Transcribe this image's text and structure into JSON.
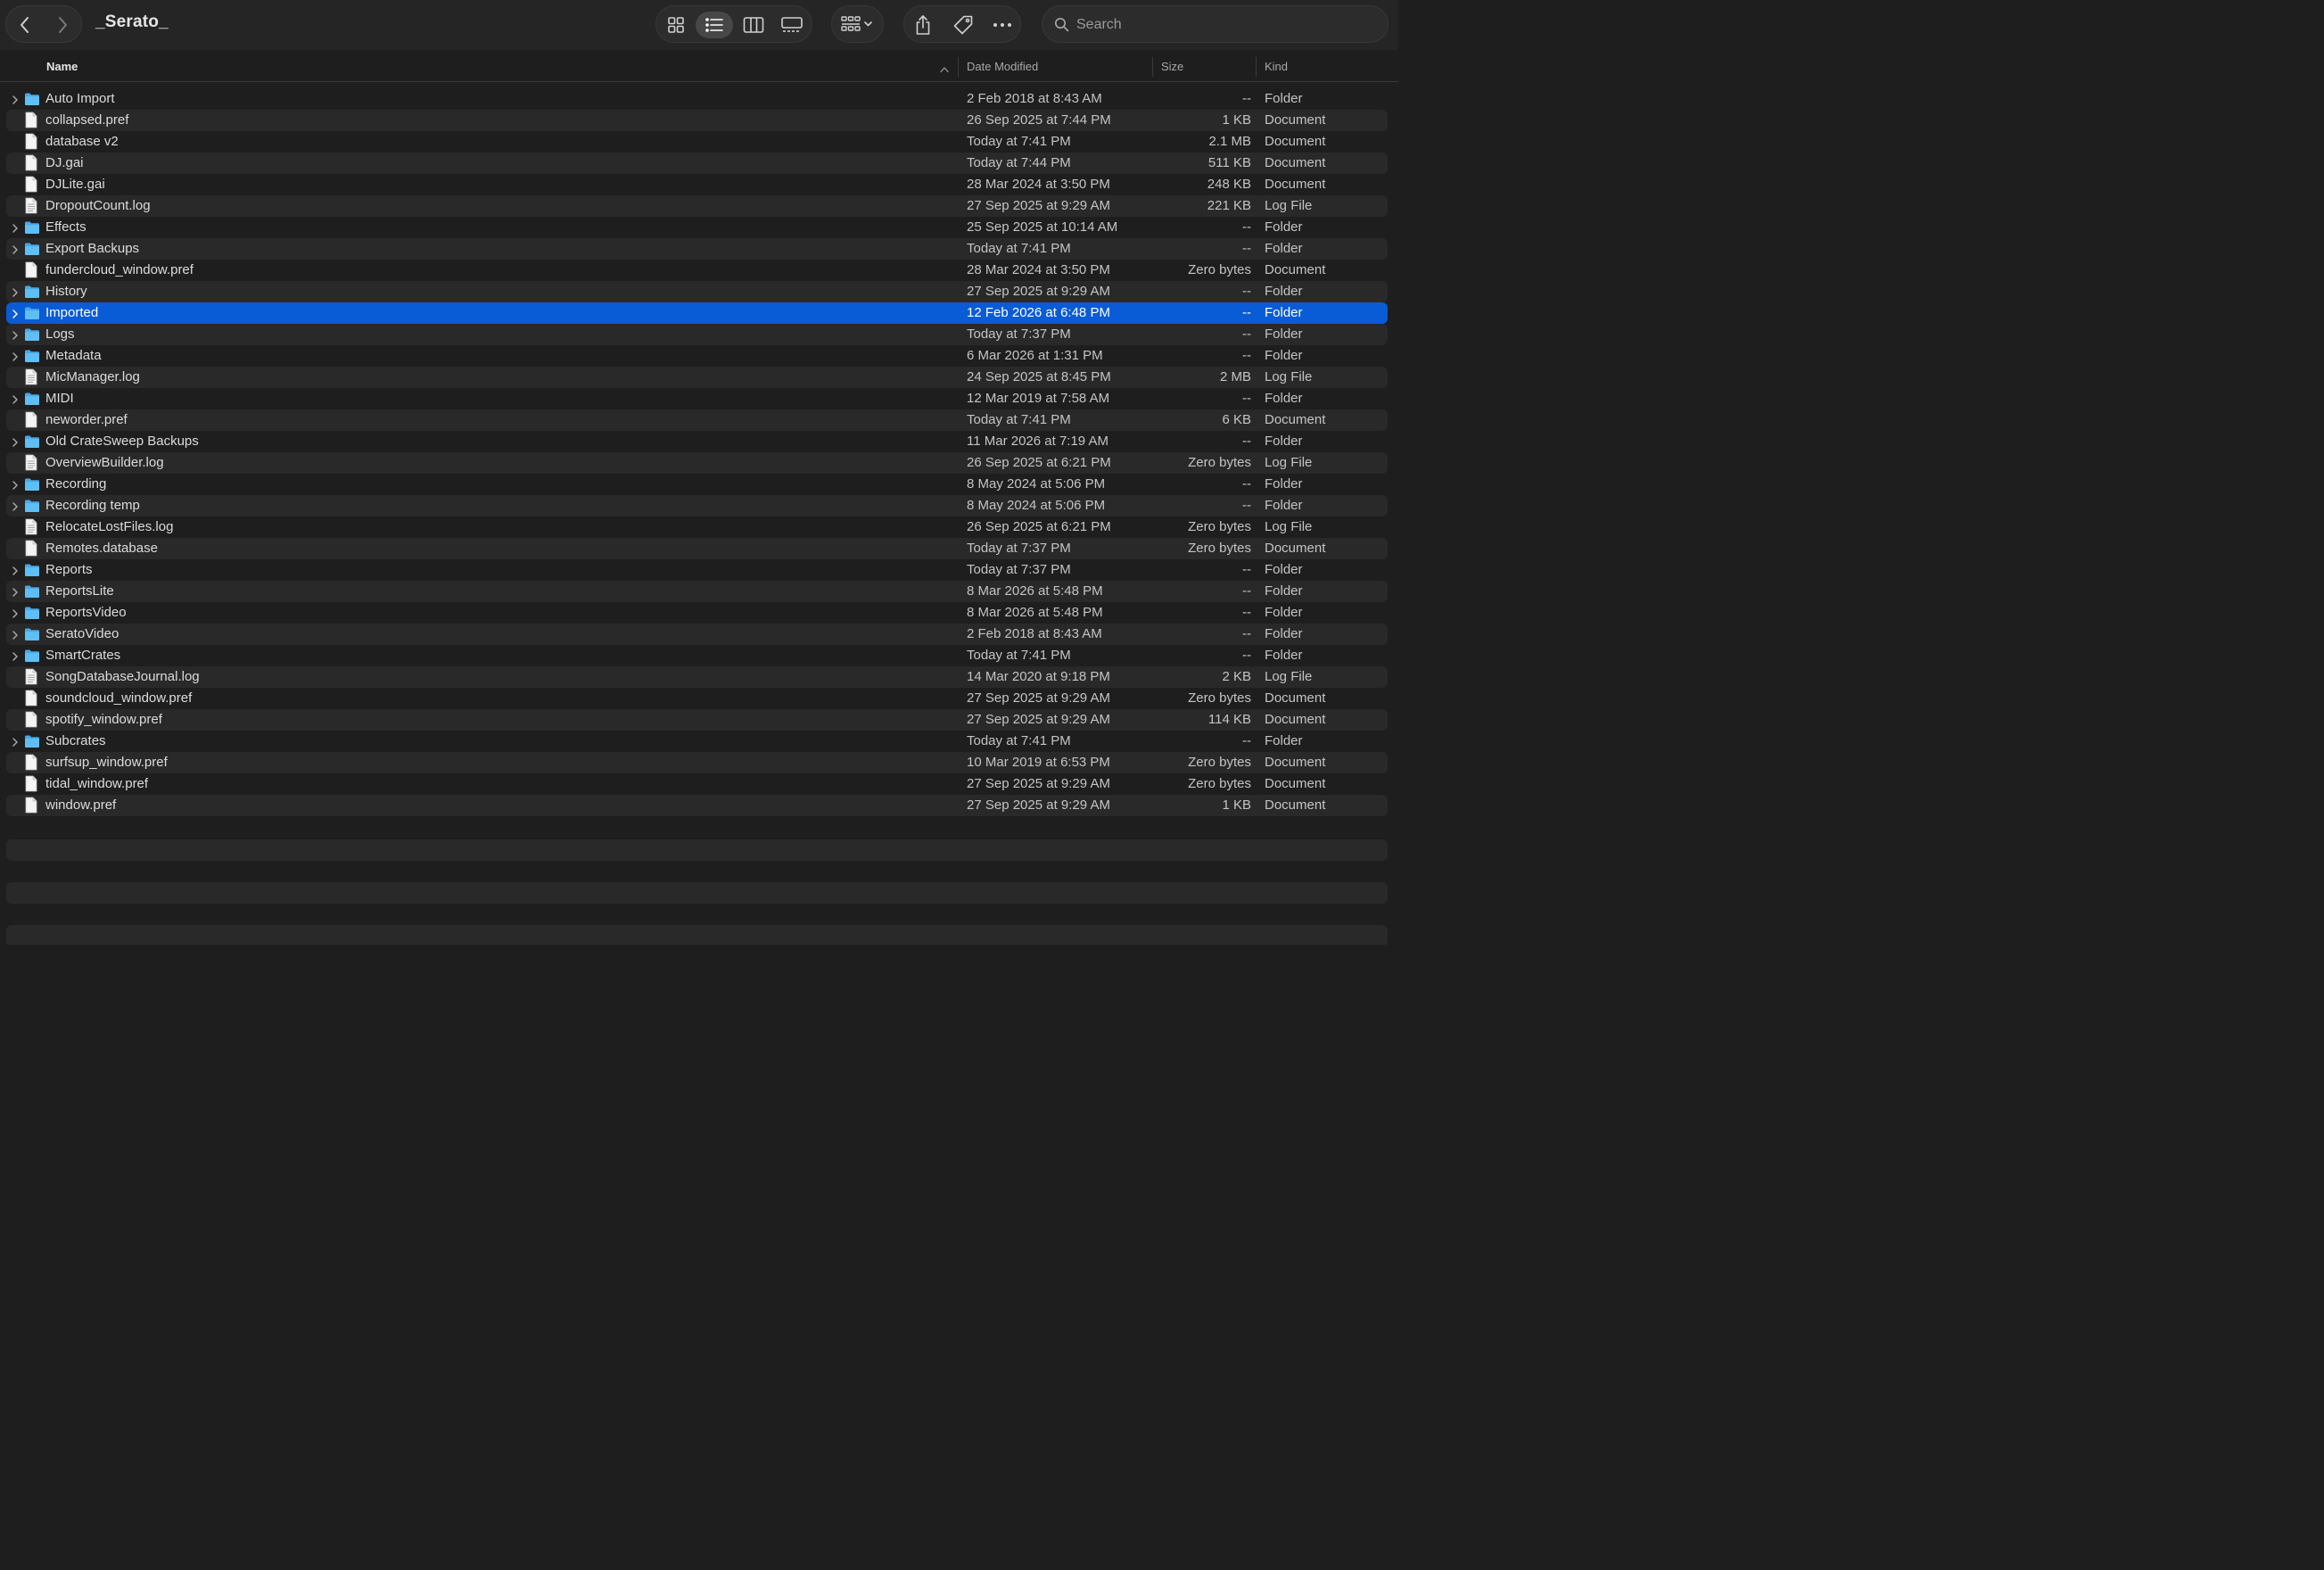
{
  "window": {
    "title": "_Serato_"
  },
  "toolbar": {
    "back_icon": "chevron-left-icon",
    "forward_icon": "chevron-right-icon",
    "view_modes": [
      "icon-view",
      "list-view",
      "column-view",
      "gallery-view"
    ],
    "active_view": "list-view",
    "group_icon": "group-by-icon",
    "share_icon": "share-icon",
    "tag_icon": "tag-icon",
    "more_icon": "ellipsis-icon"
  },
  "search": {
    "placeholder": "Search",
    "value": ""
  },
  "columns": {
    "name": "Name",
    "date": "Date Modified",
    "size": "Size",
    "kind": "Kind"
  },
  "colors": {
    "selection": "#0a5bd6",
    "folder": "#4fb4f0",
    "background": "#1e1e1e"
  },
  "files": [
    {
      "name": "Auto Import",
      "date": "2 Feb 2018 at 8:43 AM",
      "size": "--",
      "kind": "Folder",
      "folder": true
    },
    {
      "name": "collapsed.pref",
      "date": "26 Sep 2025 at 7:44 PM",
      "size": "1 KB",
      "kind": "Document",
      "folder": false
    },
    {
      "name": "database v2",
      "date": "Today at 7:41 PM",
      "size": "2.1 MB",
      "kind": "Document",
      "folder": false
    },
    {
      "name": "DJ.gai",
      "date": "Today at 7:44 PM",
      "size": "511 KB",
      "kind": "Document",
      "folder": false
    },
    {
      "name": "DJLite.gai",
      "date": "28 Mar 2024 at 3:50 PM",
      "size": "248 KB",
      "kind": "Document",
      "folder": false
    },
    {
      "name": "DropoutCount.log",
      "date": "27 Sep 2025 at 9:29 AM",
      "size": "221 KB",
      "kind": "Log File",
      "folder": false
    },
    {
      "name": "Effects",
      "date": "25 Sep 2025 at 10:14 AM",
      "size": "--",
      "kind": "Folder",
      "folder": true
    },
    {
      "name": "Export Backups",
      "date": "Today at 7:41 PM",
      "size": "--",
      "kind": "Folder",
      "folder": true
    },
    {
      "name": "fundercloud_window.pref",
      "date": "28 Mar 2024 at 3:50 PM",
      "size": "Zero bytes",
      "kind": "Document",
      "folder": false
    },
    {
      "name": "History",
      "date": "27 Sep 2025 at 9:29 AM",
      "size": "--",
      "kind": "Folder",
      "folder": true
    },
    {
      "name": "Imported",
      "date": "12 Feb 2026 at 6:48 PM",
      "size": "--",
      "kind": "Folder",
      "folder": true,
      "selected": true
    },
    {
      "name": "Logs",
      "date": "Today at 7:37 PM",
      "size": "--",
      "kind": "Folder",
      "folder": true
    },
    {
      "name": "Metadata",
      "date": "6 Mar 2026 at 1:31 PM",
      "size": "--",
      "kind": "Folder",
      "folder": true
    },
    {
      "name": "MicManager.log",
      "date": "24 Sep 2025 at 8:45 PM",
      "size": "2 MB",
      "kind": "Log File",
      "folder": false
    },
    {
      "name": "MIDI",
      "date": "12 Mar 2019 at 7:58 AM",
      "size": "--",
      "kind": "Folder",
      "folder": true
    },
    {
      "name": "neworder.pref",
      "date": "Today at 7:41 PM",
      "size": "6 KB",
      "kind": "Document",
      "folder": false
    },
    {
      "name": "Old CrateSweep Backups",
      "date": "11 Mar 2026 at 7:19 AM",
      "size": "--",
      "kind": "Folder",
      "folder": true
    },
    {
      "name": "OverviewBuilder.log",
      "date": "26 Sep 2025 at 6:21 PM",
      "size": "Zero bytes",
      "kind": "Log File",
      "folder": false
    },
    {
      "name": "Recording",
      "date": "8 May 2024 at 5:06 PM",
      "size": "--",
      "kind": "Folder",
      "folder": true
    },
    {
      "name": "Recording temp",
      "date": "8 May 2024 at 5:06 PM",
      "size": "--",
      "kind": "Folder",
      "folder": true
    },
    {
      "name": "RelocateLostFiles.log",
      "date": "26 Sep 2025 at 6:21 PM",
      "size": "Zero bytes",
      "kind": "Log File",
      "folder": false
    },
    {
      "name": "Remotes.database",
      "date": "Today at 7:37 PM",
      "size": "Zero bytes",
      "kind": "Document",
      "folder": false
    },
    {
      "name": "Reports",
      "date": "Today at 7:37 PM",
      "size": "--",
      "kind": "Folder",
      "folder": true
    },
    {
      "name": "ReportsLite",
      "date": "8 Mar 2026 at 5:48 PM",
      "size": "--",
      "kind": "Folder",
      "folder": true
    },
    {
      "name": "ReportsVideo",
      "date": "8 Mar 2026 at 5:48 PM",
      "size": "--",
      "kind": "Folder",
      "folder": true
    },
    {
      "name": "SeratoVideo",
      "date": "2 Feb 2018 at 8:43 AM",
      "size": "--",
      "kind": "Folder",
      "folder": true
    },
    {
      "name": "SmartCrates",
      "date": "Today at 7:41 PM",
      "size": "--",
      "kind": "Folder",
      "folder": true
    },
    {
      "name": "SongDatabaseJournal.log",
      "date": "14 Mar 2020 at 9:18 PM",
      "size": "2 KB",
      "kind": "Log File",
      "folder": false
    },
    {
      "name": "soundcloud_window.pref",
      "date": "27 Sep 2025 at 9:29 AM",
      "size": "Zero bytes",
      "kind": "Document",
      "folder": false
    },
    {
      "name": "spotify_window.pref",
      "date": "27 Sep 2025 at 9:29 AM",
      "size": "114 KB",
      "kind": "Document",
      "folder": false
    },
    {
      "name": "Subcrates",
      "date": "Today at 7:41 PM",
      "size": "--",
      "kind": "Folder",
      "folder": true
    },
    {
      "name": "surfsup_window.pref",
      "date": "10 Mar 2019 at 6:53 PM",
      "size": "Zero bytes",
      "kind": "Document",
      "folder": false
    },
    {
      "name": "tidal_window.pref",
      "date": "27 Sep 2025 at 9:29 AM",
      "size": "Zero bytes",
      "kind": "Document",
      "folder": false
    },
    {
      "name": "window.pref",
      "date": "27 Sep 2025 at 9:29 AM",
      "size": "1 KB",
      "kind": "Document",
      "folder": false
    }
  ]
}
